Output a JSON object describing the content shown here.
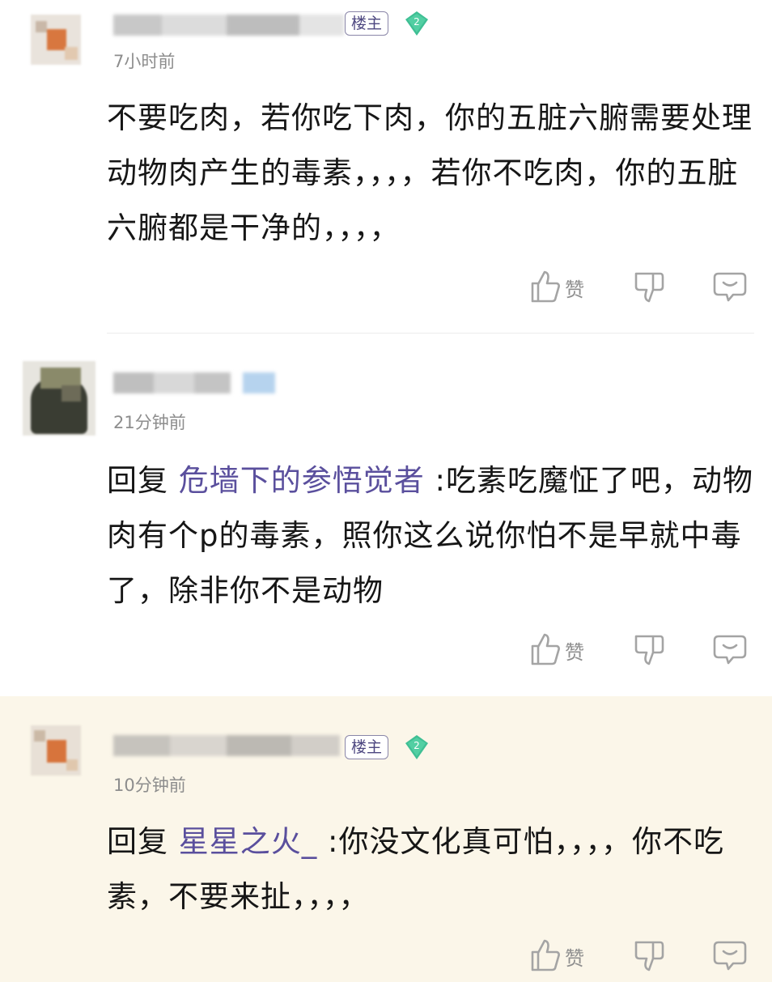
{
  "comments": [
    {
      "author_badge": "楼主",
      "level": "2",
      "time": "7小时前",
      "reply_prefix": "",
      "mention": "",
      "body": "不要吃肉，若你吃下肉，你的五脏六腑需要处理动物肉产生的毒素，，，，若你不吃肉，你的五脏六腑都是干净的，，，，",
      "like_label": "赞"
    },
    {
      "author_badge": "",
      "level": "",
      "time": "21分钟前",
      "reply_prefix": "回复",
      "mention": "危墙下的参悟觉者",
      "body": " :吃素吃魔怔了吧，动物肉有个p的毒素，照你这么说你怕不是早就中毒了，除非你不是动物",
      "like_label": "赞"
    },
    {
      "author_badge": "楼主",
      "level": "2",
      "time": "10分钟前",
      "reply_prefix": "回复",
      "mention": "星星之火_",
      "body": " :你没文化真可怕，，，，你不吃素，不要来扯，，，，",
      "like_label": "赞"
    }
  ],
  "colors": {
    "mention": "#5a4f9d",
    "badge_border": "#8a86a8",
    "level_green": "#3fbf94",
    "highlight_bg": "#fbf6e9"
  },
  "icons": [
    "thumbs-up-icon",
    "thumbs-down-icon",
    "comment-bubble-icon",
    "diamond-level-icon"
  ]
}
